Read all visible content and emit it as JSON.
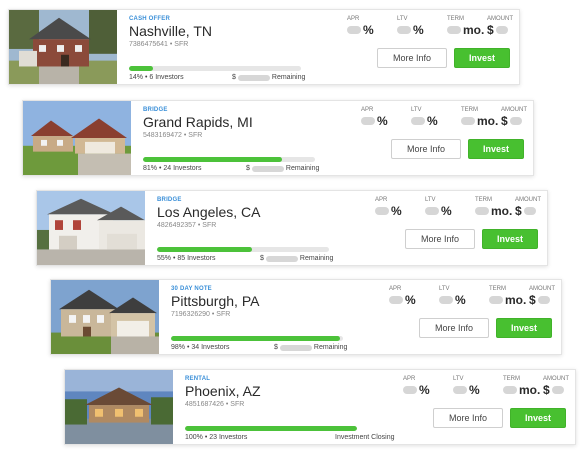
{
  "labels": {
    "apr": "APR",
    "ltv": "LTV",
    "term": "TERM",
    "amount": "AMOUNT",
    "percent": "%",
    "mo": "mo.",
    "dollar": "$",
    "more_info": "More Info",
    "invest": "Invest",
    "remaining": "Remaining",
    "closing": "Investment Closing"
  },
  "colors": {
    "accent_green": "#48c030",
    "loan_type_blue": "#3a8fd8",
    "progress_track": "#e6e6e6"
  },
  "listings": [
    {
      "loan_type": "CASH OFFER",
      "city": "Nashville, TN",
      "id": "7386475641",
      "property_type": "SFR",
      "progress_fraction": 0.14,
      "stats": "14% • 6 Investors",
      "status": "remaining"
    },
    {
      "loan_type": "BRIDGE",
      "city": "Grand Rapids, MI",
      "id": "5483169472",
      "property_type": "SFR",
      "progress_fraction": 0.81,
      "stats": "81% • 24 Investors",
      "status": "remaining"
    },
    {
      "loan_type": "BRIDGE",
      "city": "Los Angeles, CA",
      "id": "4826492357",
      "property_type": "SFR",
      "progress_fraction": 0.55,
      "stats": "55% • 85 Investors",
      "status": "remaining"
    },
    {
      "loan_type": "30 DAY NOTE",
      "city": "Pittsburgh, PA",
      "id": "7196326290",
      "property_type": "SFR",
      "progress_fraction": 0.98,
      "stats": "98% • 34 Investors",
      "status": "remaining"
    },
    {
      "loan_type": "RENTAL",
      "city": "Phoenix, AZ",
      "id": "4851687426",
      "property_type": "SFR",
      "progress_fraction": 1.0,
      "stats": "100% • 23 Investors",
      "status": "closing"
    }
  ]
}
